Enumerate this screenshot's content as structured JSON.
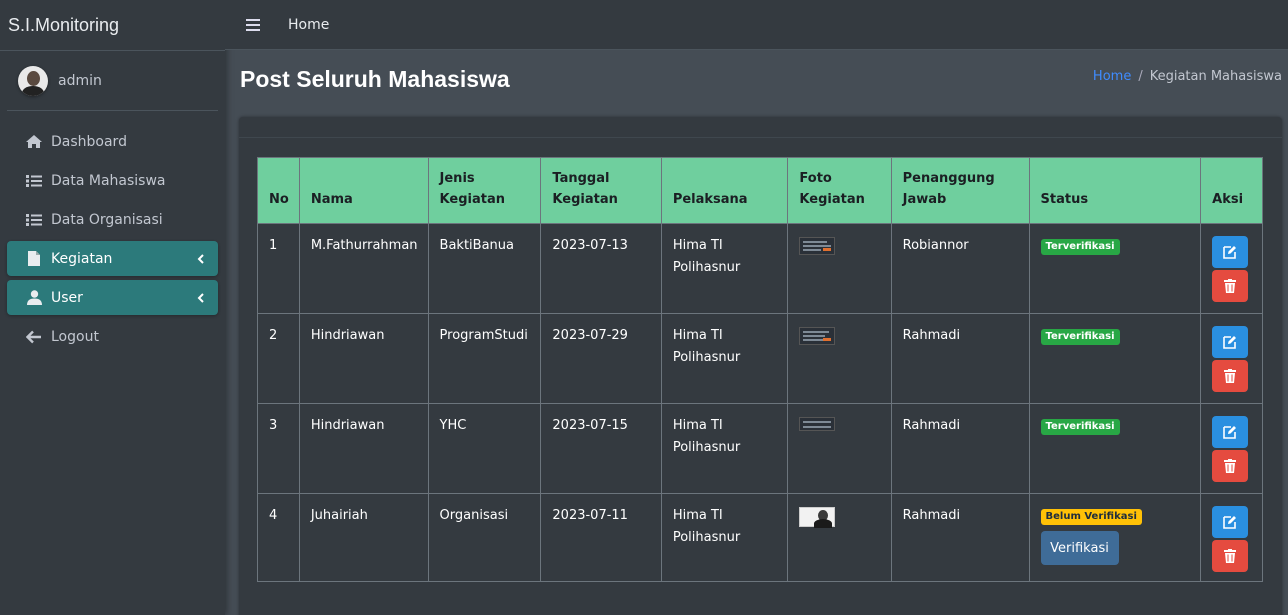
{
  "app": {
    "title": "S.I.Monitoring"
  },
  "user": {
    "name": "admin"
  },
  "sidebar": {
    "items": [
      {
        "label": "Dashboard",
        "icon": "home-icon",
        "active": false
      },
      {
        "label": "Data Mahasiswa",
        "icon": "list-icon",
        "active": false
      },
      {
        "label": "Data Organisasi",
        "icon": "list-icon",
        "active": false
      },
      {
        "label": "Kegiatan",
        "icon": "file-icon",
        "active": true
      },
      {
        "label": "User",
        "icon": "user-icon",
        "active": true
      },
      {
        "label": "Logout",
        "icon": "arrow-left-icon",
        "active": false
      }
    ]
  },
  "topbar": {
    "home": "Home"
  },
  "page": {
    "title": "Post Seluruh Mahasiswa",
    "breadcrumb": {
      "home": "Home",
      "separator": "/",
      "current": "Kegiatan Mahasiswa"
    }
  },
  "table": {
    "headers": {
      "no": "No",
      "nama": "Nama",
      "jenis_1": "Jenis",
      "jenis_2": "Kegiatan",
      "tanggal_1": "Tanggal",
      "tanggal_2": "Kegiatan",
      "pelaksana": "Pelaksana",
      "foto_1": "Foto",
      "foto_2": "Kegiatan",
      "pj_1": "Penanggung",
      "pj_2": "Jawab",
      "status": "Status",
      "aksi": "Aksi"
    },
    "rows": [
      {
        "no": "1",
        "nama": "M.Fathurrahman",
        "jenis": "BaktiBanua",
        "tanggal": "2023-07-13",
        "pelaksana_1": "Hima TI",
        "pelaksana_2": "Polihasnur",
        "pj": "Robiannor",
        "status": "Terverifikasi"
      },
      {
        "no": "2",
        "nama": "Hindriawan",
        "jenis": "ProgramStudi",
        "tanggal": "2023-07-29",
        "pelaksana_1": "Hima TI",
        "pelaksana_2": "Polihasnur",
        "pj": "Rahmadi",
        "status": "Terverifikasi"
      },
      {
        "no": "3",
        "nama": "Hindriawan",
        "jenis": "YHC",
        "tanggal": "2023-07-15",
        "pelaksana_1": "Hima TI",
        "pelaksana_2": "Polihasnur",
        "pj": "Rahmadi",
        "status": "Terverifikasi"
      },
      {
        "no": "4",
        "nama": "Juhairiah",
        "jenis": "Organisasi",
        "tanggal": "2023-07-11",
        "pelaksana_1": "Hima TI",
        "pelaksana_2": "Polihasnur",
        "pj": "Rahmadi",
        "status": "Belum Verifikasi",
        "verify_label": "Verifikasi"
      }
    ]
  },
  "colors": {
    "sidebar_bg": "#343a40",
    "content_bg": "#454d55",
    "active_nav": "#2c7a7b",
    "table_header": "#6fcf9e",
    "badge_ok": "#28a745",
    "badge_warn": "#ffc107",
    "edit_button": "#2a8fe0",
    "delete_button": "#e54b3f",
    "verify_button": "#3f6c98",
    "breadcrumb_link": "#3f8cff"
  }
}
